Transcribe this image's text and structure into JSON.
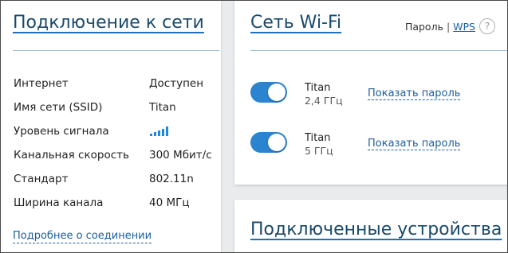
{
  "connection": {
    "title": "Подключение к сети",
    "rows": [
      {
        "label": "Интернет",
        "value": "Доступен"
      },
      {
        "label": "Имя сети (SSID)",
        "value": "Titan"
      },
      {
        "label": "Уровень сигнала",
        "value": "",
        "signal_level": 1.0
      },
      {
        "label": "Канальная скорость",
        "value": "300 Мбит/с"
      },
      {
        "label": "Стандарт",
        "value": "802.11n"
      },
      {
        "label": "Ширина канала",
        "value": "40 МГц"
      }
    ],
    "more_link": "Подробнее о соединении"
  },
  "wifi": {
    "title": "Сеть Wi-Fi",
    "password_link": "Пароль",
    "separator": "|",
    "wps_link": "WPS",
    "help_icon_glyph": "?",
    "networks": [
      {
        "name": "Titan",
        "band": "2,4 ГГц",
        "enabled": true,
        "show_password": "Показать пароль"
      },
      {
        "name": "Titan",
        "band": "5 ГГц",
        "enabled": true,
        "show_password": "Показать пароль"
      }
    ]
  },
  "devices": {
    "title": "Подключенные устройства"
  },
  "colors": {
    "accent": "#1e88e5",
    "toggle_on": "#2a84d0",
    "link": "#1d5e9f",
    "title": "#1a4a6b"
  }
}
